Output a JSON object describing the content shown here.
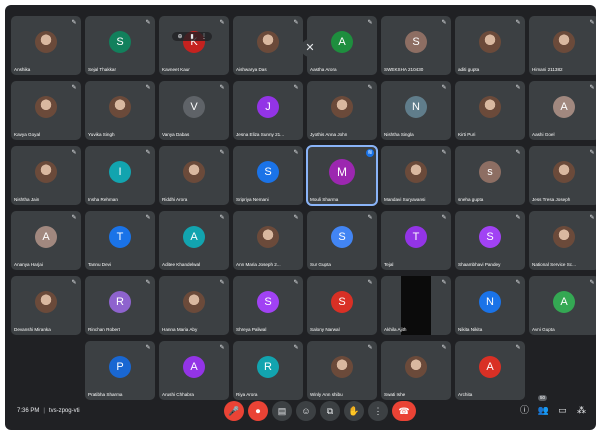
{
  "colors": {
    "background": "#202124",
    "tile": "#3c4043",
    "speaking_outline": "#8ab4f8",
    "end_call": "#ea4335"
  },
  "participants": [
    {
      "name": "Anshika",
      "initial": "",
      "color": "",
      "photo": true
    },
    {
      "name": "Sejal Thakkar",
      "initial": "S",
      "color": "#12805c"
    },
    {
      "name": "Kavneet Kaur",
      "initial": "K",
      "color": "#c5221f",
      "hover": true
    },
    {
      "name": "Aishwarya Das",
      "initial": "",
      "color": "",
      "photo": true
    },
    {
      "name": "Aastha Arora",
      "initial": "A",
      "color": "#1e8e3e"
    },
    {
      "name": "SWEKSHA 210430",
      "initial": "S",
      "color": "#8d6e63"
    },
    {
      "name": "aditi gupta",
      "initial": "",
      "color": "",
      "photo": true
    },
    {
      "name": "Himani 211382",
      "initial": "",
      "color": "",
      "photo": true
    },
    {
      "name": "Kavya Goyal",
      "initial": "",
      "color": "",
      "photo": true
    },
    {
      "name": "Yuvika Singh",
      "initial": "",
      "color": "",
      "photo": true
    },
    {
      "name": "Vanya Dabas",
      "initial": "V",
      "color": "#5f6368"
    },
    {
      "name": "Jesna Eliza Sunny 21...",
      "initial": "J",
      "color": "#9334e6"
    },
    {
      "name": "Jyothis Anna John",
      "initial": "",
      "color": "",
      "photo": true
    },
    {
      "name": "Nishtha Singla",
      "initial": "N",
      "color": "#607d8b"
    },
    {
      "name": "Kirti Puri",
      "initial": "",
      "color": "",
      "photo": true
    },
    {
      "name": "Aashi Goel",
      "initial": "A",
      "color": "#a1887f"
    },
    {
      "name": "Nishtha Jain",
      "initial": "",
      "color": "",
      "photo": true
    },
    {
      "name": "Insha Rehman",
      "initial": "I",
      "color": "#12a4af"
    },
    {
      "name": "Riddhi Arora",
      "initial": "",
      "color": "",
      "photo": true
    },
    {
      "name": "Sripriya Nemani",
      "initial": "S",
      "color": "#1a73e8"
    },
    {
      "name": "Mouli Sharma",
      "initial": "M",
      "color": "#9c27b0",
      "speaking": true,
      "big": true
    },
    {
      "name": "Mandavi Suryavansi",
      "initial": "",
      "color": "",
      "photo": true
    },
    {
      "name": "sneha gupta",
      "initial": "s",
      "color": "#8d6e63"
    },
    {
      "name": "Jess Tresa Joseph",
      "initial": "",
      "color": "",
      "photo": true
    },
    {
      "name": "Ananya Harjai",
      "initial": "A",
      "color": "#a1887f"
    },
    {
      "name": "Tannu Devi",
      "initial": "T",
      "color": "#1a73e8"
    },
    {
      "name": "Aditee Khandelwal",
      "initial": "A",
      "color": "#12a4af"
    },
    {
      "name": "Ann Maria Joseph 2...",
      "initial": "",
      "color": "",
      "photo": true
    },
    {
      "name": "Sur Gupta",
      "initial": "S",
      "color": "#4285f4"
    },
    {
      "name": "Tejal",
      "initial": "T",
      "color": "#9334e6"
    },
    {
      "name": "Shaambhavi Pandey",
      "initial": "S",
      "color": "#a142f4"
    },
    {
      "name": "National Service Sc...",
      "initial": "",
      "color": "",
      "photo": true
    },
    {
      "name": "Devanshi Miranka",
      "initial": "",
      "color": "",
      "photo": true
    },
    {
      "name": "Rinchan Robert",
      "initial": "R",
      "color": "#8e63ce"
    },
    {
      "name": "Hanna Maria Aby",
      "initial": "",
      "color": "",
      "photo": true
    },
    {
      "name": "Shreya Paliwal",
      "initial": "S",
      "color": "#a142f4"
    },
    {
      "name": "Salony Narwal",
      "initial": "S",
      "color": "#d93025"
    },
    {
      "name": "Akhila Ajith",
      "initial": "",
      "color": "",
      "dark": true
    },
    {
      "name": "Nikita Nikita",
      "initial": "N",
      "color": "#1a73e8"
    },
    {
      "name": "Avni Gupta",
      "initial": "A",
      "color": "#34a853"
    },
    {
      "empty": true
    },
    {
      "name": "Pratibha Sharma",
      "initial": "P",
      "color": "#1967d2"
    },
    {
      "name": "Arushi Chhabra",
      "initial": "A",
      "color": "#9334e6"
    },
    {
      "name": "Riya Arora",
      "initial": "R",
      "color": "#12a4af"
    },
    {
      "name": "Winly Ann shibu",
      "initial": "",
      "color": "",
      "photo": true
    },
    {
      "name": "Swati Ishe",
      "initial": "",
      "color": "",
      "photo": true
    },
    {
      "name": "Archita",
      "initial": "A",
      "color": "#d93025"
    }
  ],
  "meeting": {
    "time": "7:36 PM",
    "separator": "|",
    "code": "tvs-zpog-vti"
  },
  "controls": [
    {
      "name": "mic-off-button",
      "icon": "mic-off-icon",
      "glyph": "🎤",
      "red": true
    },
    {
      "name": "camera-off-button",
      "icon": "camera-off-icon",
      "glyph": "⏺",
      "red": true
    },
    {
      "name": "captions-button",
      "icon": "captions-icon",
      "glyph": "▤"
    },
    {
      "name": "emoji-button",
      "icon": "emoji-icon",
      "glyph": "☺"
    },
    {
      "name": "present-button",
      "icon": "present-icon",
      "glyph": "⧉"
    },
    {
      "name": "raise-hand-button",
      "icon": "hand-icon",
      "glyph": "✋"
    },
    {
      "name": "more-options-button",
      "icon": "more-vert-icon",
      "glyph": "⋮"
    },
    {
      "name": "leave-call-button",
      "icon": "end-call-icon",
      "glyph": "☎",
      "leave": true
    }
  ],
  "right_controls": [
    {
      "name": "meeting-details-button",
      "icon": "info-icon",
      "glyph": "ⓘ"
    },
    {
      "name": "people-button",
      "icon": "people-icon",
      "glyph": "👥",
      "badge": "50"
    },
    {
      "name": "chat-button",
      "icon": "chat-icon",
      "glyph": "▭"
    },
    {
      "name": "activities-button",
      "icon": "activities-icon",
      "glyph": "⁂"
    }
  ]
}
